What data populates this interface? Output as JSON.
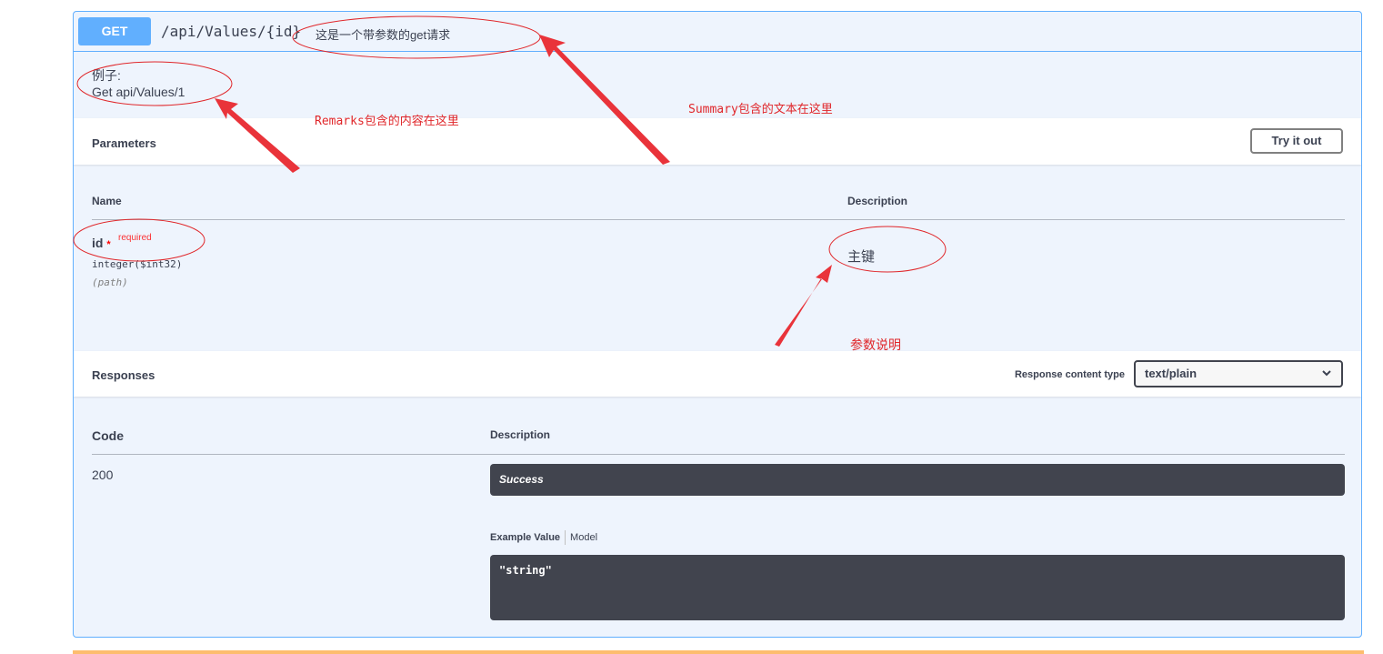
{
  "operation": {
    "method": "GET",
    "path": "/api/Values/{id}",
    "summary": "这是一个带参数的get请求",
    "remarks_line1": "例子:",
    "remarks_line2": "Get api/Values/1"
  },
  "parameters": {
    "title": "Parameters",
    "try_button": "Try it out",
    "col_name": "Name",
    "col_description": "Description",
    "param": {
      "name": "id",
      "star": "*",
      "required": "required",
      "type": "integer($int32)",
      "in": "(path)",
      "description": "主键"
    }
  },
  "responses": {
    "title": "Responses",
    "content_type_label": "Response content type",
    "content_type_value": "text/plain",
    "col_code": "Code",
    "col_description": "Description",
    "code": "200",
    "description": "Success",
    "tab_example": "Example Value",
    "tab_model": "Model",
    "example": "\"string\""
  },
  "annotations": {
    "remarks_note": "Remarks包含的内容在这里",
    "summary_note": "Summary包含的文本在这里",
    "param_note": "参数说明",
    "color": "#e0262a"
  }
}
